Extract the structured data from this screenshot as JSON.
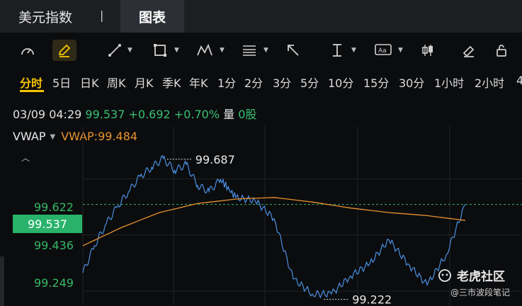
{
  "header": {
    "title": "美元指数",
    "separator": "|",
    "active_tab": "图表"
  },
  "toolbar": {
    "tools": [
      {
        "name": "indicator-gauge-icon"
      },
      {
        "name": "pen-draw-icon",
        "active": true
      },
      {
        "name": "trend-line-icon"
      },
      {
        "name": "rectangle-icon"
      },
      {
        "name": "pattern-icon"
      },
      {
        "name": "fibonacci-icon"
      },
      {
        "name": "arrow-icon"
      },
      {
        "name": "price-range-icon"
      },
      {
        "name": "text-annotation-icon"
      },
      {
        "name": "candlestick-icon"
      },
      {
        "name": "eraser-icon"
      },
      {
        "name": "lock-icon"
      }
    ]
  },
  "periods": [
    "分时",
    "5日",
    "日K",
    "周K",
    "月K",
    "季K",
    "年K",
    "1分",
    "2分",
    "3分",
    "5分",
    "10分",
    "15分",
    "30分",
    "1小时",
    "2小时",
    "4"
  ],
  "active_period": "分时",
  "info": {
    "datetime": "03/09 04:29",
    "price": "99.537",
    "change": "+0.692",
    "change_pct": "+0.70%",
    "volume_label": "量",
    "volume": "0股"
  },
  "indicator": {
    "name": "VWAP",
    "value_text": "VWAP:99.484"
  },
  "price_tag": "99.537",
  "colors": {
    "price_line": "#4a90e2",
    "vwap_line": "#e8922e",
    "up": "#38c172",
    "accent": "#f5c400"
  },
  "chart_data": {
    "type": "line",
    "y_ticks": [
      "99.622",
      "99.436",
      "99.249"
    ],
    "ylim": [
      99.2,
      99.75
    ],
    "series": [
      {
        "name": "price",
        "x": [
          0,
          3,
          6,
          9,
          12,
          15,
          18,
          21,
          24,
          27,
          30,
          33,
          36,
          40,
          45,
          50,
          55,
          60,
          65,
          70,
          75,
          80,
          85,
          90,
          95,
          100
        ],
        "y": [
          99.31,
          99.4,
          99.47,
          99.53,
          99.58,
          99.63,
          99.66,
          99.69,
          99.65,
          99.67,
          99.6,
          99.58,
          99.62,
          99.56,
          99.55,
          99.49,
          99.29,
          99.24,
          99.24,
          99.3,
          99.34,
          99.42,
          99.34,
          99.27,
          99.37,
          99.537
        ]
      },
      {
        "name": "VWAP",
        "x": [
          0,
          10,
          20,
          30,
          40,
          50,
          60,
          70,
          80,
          90,
          100
        ],
        "y": [
          99.4,
          99.46,
          99.51,
          99.54,
          99.555,
          99.56,
          99.545,
          99.525,
          99.51,
          99.5,
          99.484
        ]
      }
    ],
    "annotations": [
      {
        "text": "99.687",
        "x": 22,
        "y": 99.687
      },
      {
        "text": "99.222",
        "x": 63,
        "y": 99.222
      }
    ],
    "last_price": 99.537
  },
  "watermark": {
    "text": "老虎社区",
    "credit": "@三市波段笔记"
  }
}
